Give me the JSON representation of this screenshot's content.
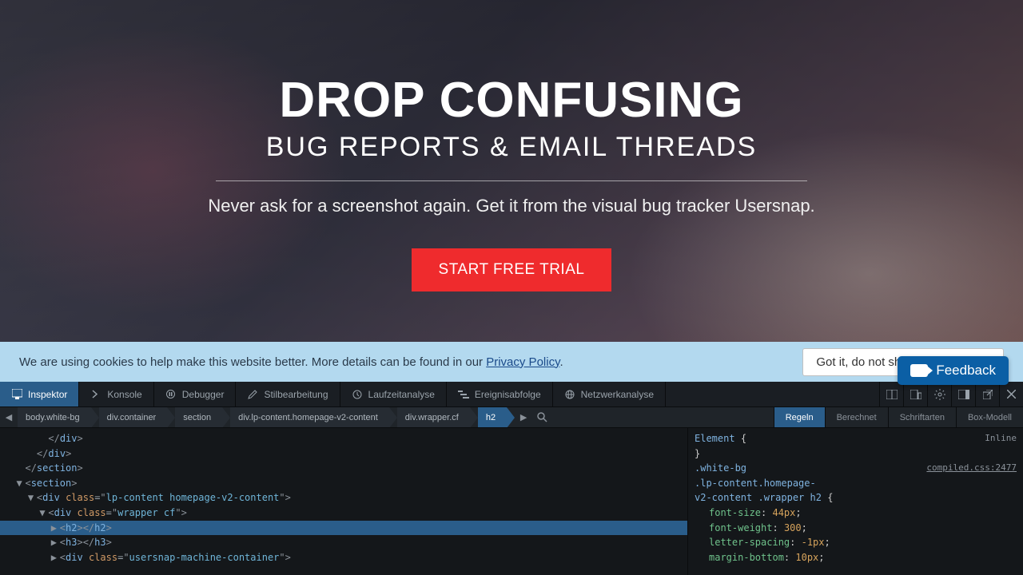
{
  "hero": {
    "heading": "DROP CONFUSING",
    "subheading": "BUG REPORTS & EMAIL THREADS",
    "tagline": "Never ask for a screenshot again. Get it from the visual bug tracker Usersnap.",
    "cta_label": "START FREE TRIAL"
  },
  "cookie_bar": {
    "message_prefix": "We are using cookies to help make this website better. More details can be found in our ",
    "privacy_link": "Privacy Policy",
    "message_suffix": ".",
    "dismiss_label": "Got it, do not show this message"
  },
  "feedback_widget": {
    "label": "Feedback"
  },
  "devtools": {
    "tabs": [
      {
        "label": "Inspektor",
        "active": true,
        "icon": "cursor-icon"
      },
      {
        "label": "Konsole",
        "active": false,
        "icon": "chevron-icon"
      },
      {
        "label": "Debugger",
        "active": false,
        "icon": "pause-icon"
      },
      {
        "label": "Stilbearbeitung",
        "active": false,
        "icon": "edit-icon"
      },
      {
        "label": "Laufzeitanalyse",
        "active": false,
        "icon": "clock-icon"
      },
      {
        "label": "Ereignisabfolge",
        "active": false,
        "icon": "timeline-icon"
      },
      {
        "label": "Netzwerkanalyse",
        "active": false,
        "icon": "network-icon"
      }
    ],
    "breadcrumbs": [
      {
        "label": "body.white-bg",
        "active": false
      },
      {
        "label": "div.container",
        "active": false
      },
      {
        "label": "section",
        "active": false
      },
      {
        "label": "div.lp-content.homepage-v2-content",
        "active": false
      },
      {
        "label": "div.wrapper.cf",
        "active": false
      },
      {
        "label": "h2",
        "active": true
      }
    ],
    "rules_tabs": [
      {
        "label": "Regeln",
        "active": true
      },
      {
        "label": "Berechnet",
        "active": false
      },
      {
        "label": "Schriftarten",
        "active": false
      },
      {
        "label": "Box-Modell",
        "active": false
      }
    ],
    "dom_lines": [
      {
        "indent": 3,
        "raw": "</div>",
        "type": "close"
      },
      {
        "indent": 2,
        "raw": "</div>",
        "type": "close"
      },
      {
        "indent": 1,
        "raw": "</section>",
        "type": "close"
      },
      {
        "indent": 1,
        "raw": "<section>",
        "type": "open",
        "twisty": "▼"
      },
      {
        "indent": 2,
        "raw_tag": "div",
        "attrs": [
          {
            "n": "class",
            "v": "lp-content homepage-v2-content"
          }
        ],
        "type": "open",
        "twisty": "▼"
      },
      {
        "indent": 3,
        "raw_tag": "div",
        "attrs": [
          {
            "n": "class",
            "v": "wrapper cf"
          }
        ],
        "type": "open",
        "twisty": "▼"
      },
      {
        "indent": 4,
        "raw": "<h2></h2>",
        "type": "leaf",
        "twisty": "▶",
        "selected": true
      },
      {
        "indent": 4,
        "raw": "<h3></h3>",
        "type": "leaf",
        "twisty": "▶"
      },
      {
        "indent": 4,
        "raw_tag": "div",
        "attrs": [
          {
            "n": "class",
            "v": "usersnap-machine-container"
          }
        ],
        "type": "open",
        "twisty": "▶"
      }
    ],
    "styles": {
      "element_block": {
        "selector": "Element",
        "badge": "Inline"
      },
      "rule": {
        "selector": ".white-bg .lp-content.homepage-v2-content .wrapper h2",
        "source": "compiled.css:2477",
        "decls": [
          {
            "prop": "font-size",
            "val": "44px"
          },
          {
            "prop": "font-weight",
            "val": "300"
          },
          {
            "prop": "letter-spacing",
            "val": "-1px"
          },
          {
            "prop": "margin-bottom",
            "val": "10px"
          }
        ]
      }
    }
  }
}
